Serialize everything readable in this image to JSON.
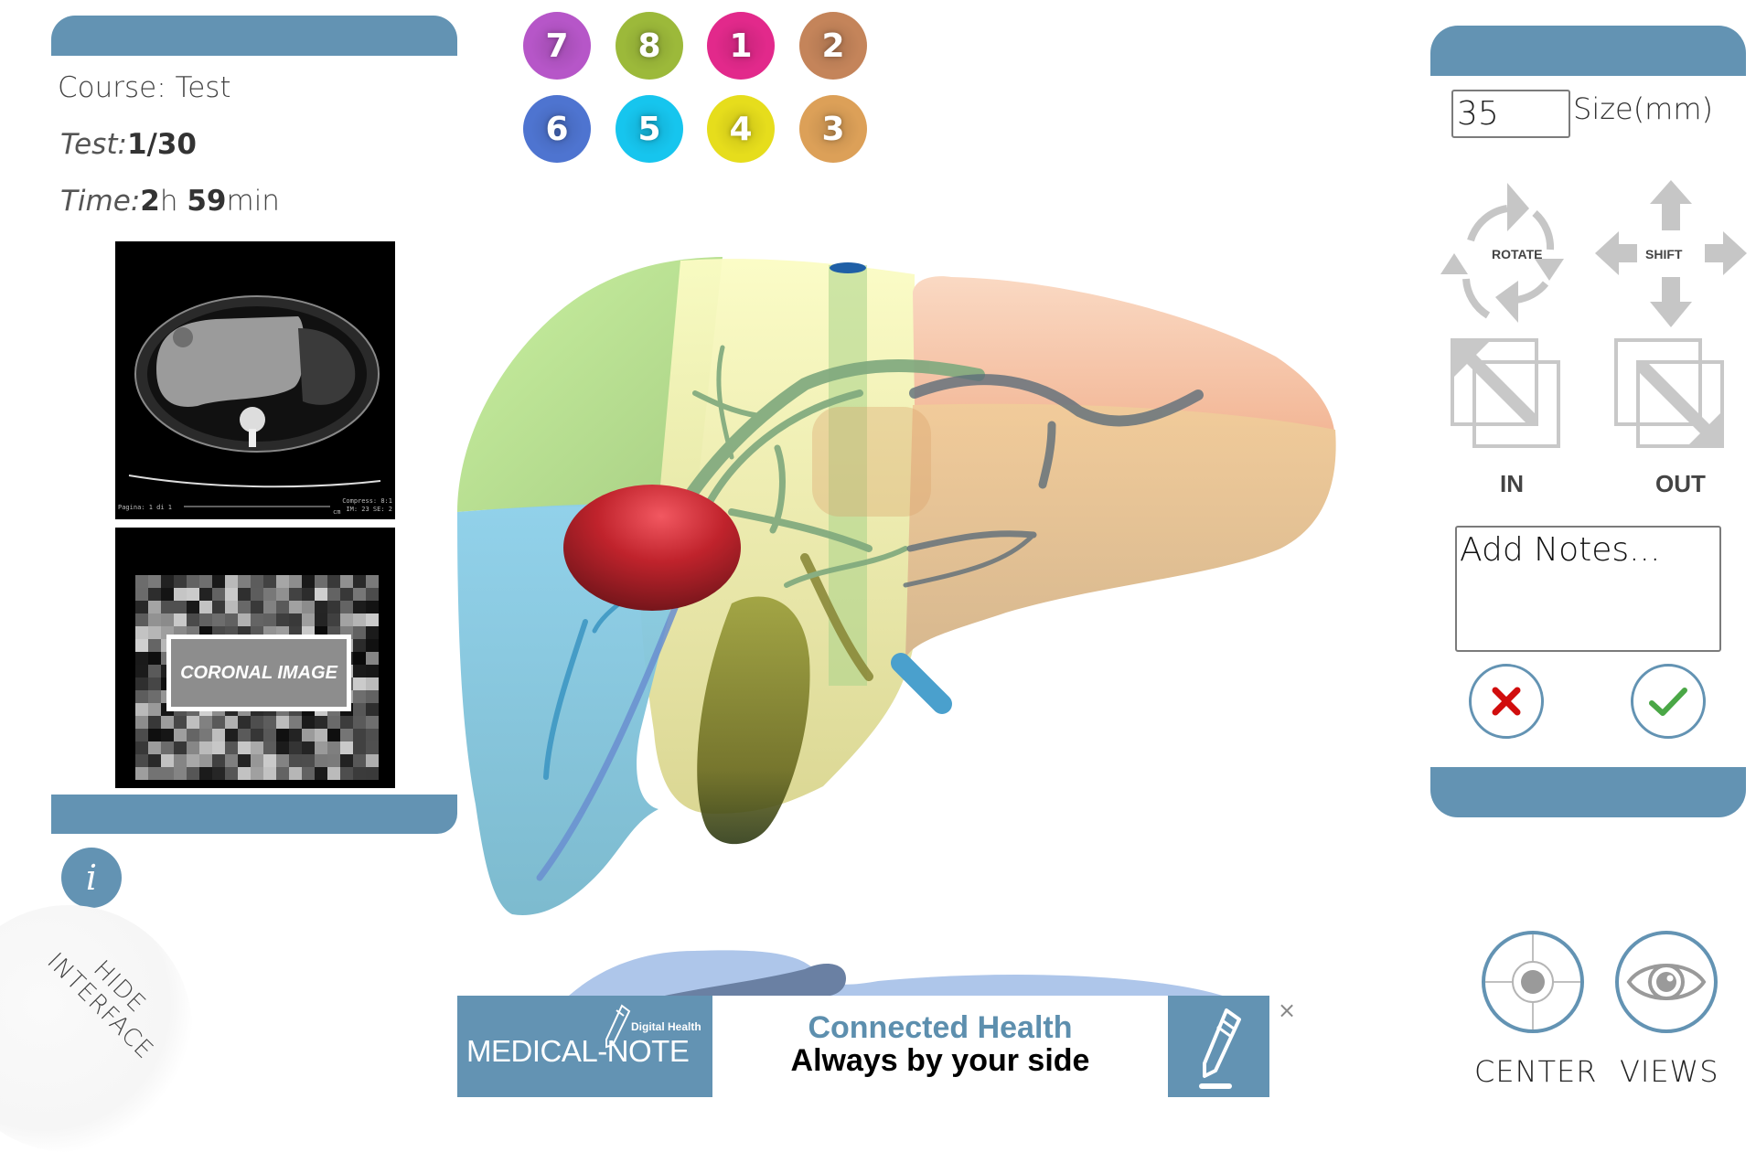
{
  "left_panel": {
    "course_label": "Course:",
    "course_value": "Test",
    "test_label": "Test:",
    "test_value": "1/30",
    "time_label": "Time:",
    "time_hours": "2",
    "time_hours_unit": "h",
    "time_minutes": "59",
    "time_minutes_unit": "min",
    "axial_image": {
      "page_text": "Pagina: 1 di 1",
      "compress_text": "Compress: 8:1",
      "series_text": "IM: 23 SE: 2",
      "scale_unit": "cm"
    },
    "coronal_image": {
      "label": "CORONAL IMAGE"
    },
    "info_button_label": "i",
    "hide_interface_label_line1": "HIDE",
    "hide_interface_label_line2": "INTERFACE"
  },
  "segments": [
    {
      "label": "7",
      "color": "#b656c8"
    },
    {
      "label": "8",
      "color": "#9cb93a"
    },
    {
      "label": "1",
      "color": "#e2298b"
    },
    {
      "label": "2",
      "color": "#c4845a"
    },
    {
      "label": "6",
      "color": "#4e74d0"
    },
    {
      "label": "5",
      "color": "#16c5ee"
    },
    {
      "label": "4",
      "color": "#e6dd1c"
    },
    {
      "label": "3",
      "color": "#dca058"
    }
  ],
  "right_panel": {
    "size_value": "35",
    "size_label": "Size(mm)",
    "rotate_label": "ROTATE",
    "shift_label": "SHIFT",
    "zoom_in_label": "IN",
    "zoom_out_label": "OUT",
    "notes_placeholder": "Add Notes...",
    "center_label": "CENTER",
    "views_label": "VIEWS"
  },
  "ad": {
    "brand": "MEDICAL-NOTE",
    "subbrand": "Digital Health",
    "headline": "Connected Health",
    "tagline": "Always by your side",
    "close_label": "×"
  },
  "colors": {
    "panel_accent": "#6393b3",
    "cancel": "#d10d0d",
    "confirm": "#4aa746",
    "tumor": "#c0232c"
  }
}
